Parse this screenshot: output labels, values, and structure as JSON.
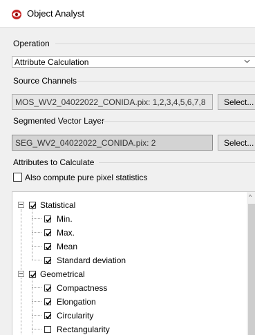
{
  "window": {
    "title": "Object Analyst"
  },
  "operation": {
    "label": "Operation",
    "value": "Attribute Calculation",
    "dropdown_icon": "chevron-down-icon"
  },
  "source_channels": {
    "label": "Source Channels",
    "value": "MOS_WV2_04022022_CONIDA.pix: 1,2,3,4,5,6,7,8",
    "button": "Select..."
  },
  "segmented_vector_layer": {
    "label": "Segmented Vector Layer",
    "value": "SEG_WV2_04022022_CONIDA.pix: 2",
    "button": "Select..."
  },
  "attributes": {
    "label": "Attributes to Calculate",
    "pure_pixel": {
      "label": "Also compute pure pixel statistics",
      "checked": false
    }
  },
  "tree": {
    "groups": [
      {
        "label": "Statistical",
        "checked": true,
        "items": [
          {
            "label": "Min.",
            "checked": true
          },
          {
            "label": "Max.",
            "checked": true
          },
          {
            "label": "Mean",
            "checked": true
          },
          {
            "label": "Standard deviation",
            "checked": true
          }
        ]
      },
      {
        "label": "Geometrical",
        "checked": true,
        "items": [
          {
            "label": "Compactness",
            "checked": true
          },
          {
            "label": "Elongation",
            "checked": true
          },
          {
            "label": "Circularity",
            "checked": true
          },
          {
            "label": "Rectangularity",
            "checked": false
          }
        ]
      }
    ]
  }
}
